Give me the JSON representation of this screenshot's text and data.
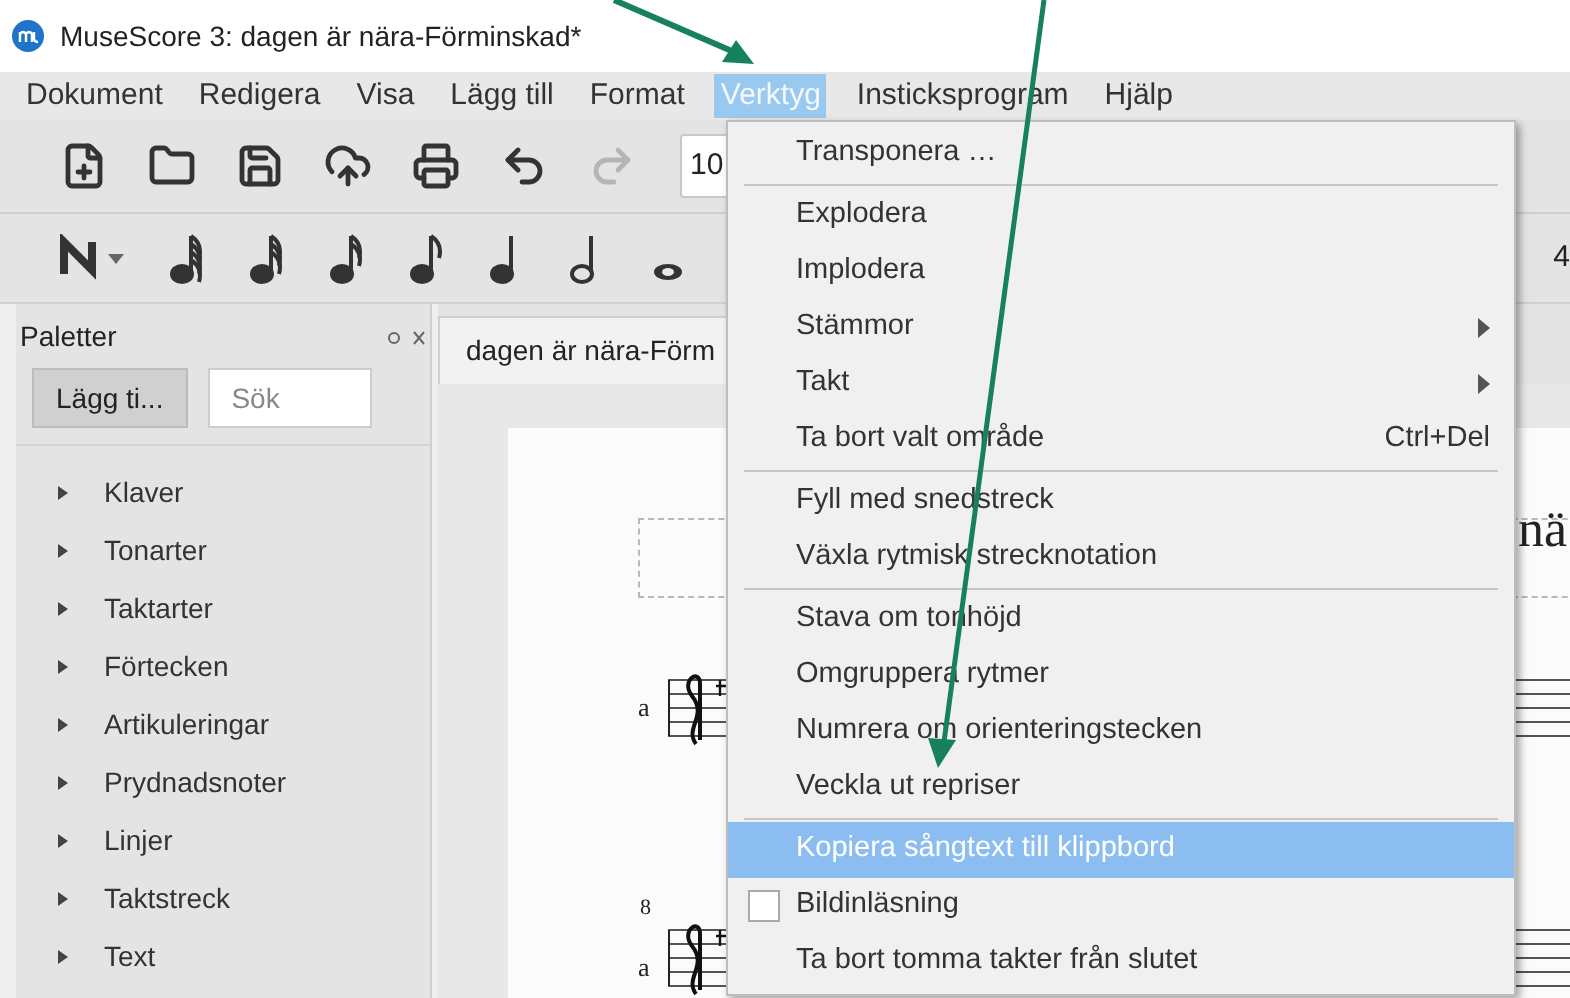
{
  "window": {
    "title": "MuseScore 3: dagen är nära-Förminskad*"
  },
  "menubar": [
    {
      "label": "Dokument",
      "selected": false
    },
    {
      "label": "Redigera",
      "selected": false
    },
    {
      "label": "Visa",
      "selected": false
    },
    {
      "label": "Lägg till",
      "selected": false
    },
    {
      "label": "Format",
      "selected": false
    },
    {
      "label": "Verktyg",
      "selected": true
    },
    {
      "label": "Insticksprogram",
      "selected": false
    },
    {
      "label": "Hjälp",
      "selected": false
    }
  ],
  "file_toolbar": {
    "buttons": [
      {
        "kind": "new",
        "disabled": false
      },
      {
        "kind": "open",
        "disabled": false
      },
      {
        "kind": "save",
        "disabled": false
      },
      {
        "kind": "upload",
        "disabled": false
      },
      {
        "kind": "print",
        "disabled": false
      },
      {
        "kind": "undo",
        "disabled": false
      },
      {
        "kind": "redo",
        "disabled": true
      }
    ],
    "zoom_value": "10"
  },
  "note_toolbar": {
    "buttons": [
      {
        "kind": "note-input"
      },
      {
        "kind": "n64"
      },
      {
        "kind": "n32"
      },
      {
        "kind": "n16"
      },
      {
        "kind": "n8"
      },
      {
        "kind": "n4"
      },
      {
        "kind": "n2"
      },
      {
        "kind": "n1"
      }
    ],
    "trailing": "4"
  },
  "palette": {
    "title": "Paletter",
    "add_button": "Lägg ti...",
    "search": {
      "placeholder": "Sök"
    },
    "items": [
      {
        "label": "Klaver",
        "expanded": false
      },
      {
        "label": "Tonarter",
        "expanded": false
      },
      {
        "label": "Taktarter",
        "expanded": false
      },
      {
        "label": "Förtecken",
        "expanded": false
      },
      {
        "label": "Artikuleringar",
        "expanded": false
      },
      {
        "label": "Prydnadsnoter",
        "expanded": false
      },
      {
        "label": "Linjer",
        "expanded": false
      },
      {
        "label": "Taktstreck",
        "expanded": false
      },
      {
        "label": "Text",
        "expanded": false
      }
    ]
  },
  "score": {
    "tab": "dagen är nära-Förm",
    "title_fragment": "nä",
    "staves": [
      {
        "label": "a"
      },
      {
        "label": "a",
        "octave_mark": "8"
      }
    ]
  },
  "menu": {
    "items": [
      {
        "kind": "item",
        "label": "Transponera …",
        "selected": false
      },
      {
        "kind": "separator"
      },
      {
        "kind": "item",
        "label": "Explodera",
        "selected": false
      },
      {
        "kind": "item",
        "label": "Implodera",
        "selected": false
      },
      {
        "kind": "submenu",
        "label": "Stämmor",
        "selected": false
      },
      {
        "kind": "submenu",
        "label": "Takt",
        "selected": false
      },
      {
        "kind": "item",
        "label": "Ta bort valt område",
        "shortcut": "Ctrl+Del",
        "selected": false
      },
      {
        "kind": "separator"
      },
      {
        "kind": "item",
        "label": "Fyll med snedstreck",
        "selected": false
      },
      {
        "kind": "item",
        "label": "Växla rytmisk strecknotation",
        "selected": false
      },
      {
        "kind": "separator"
      },
      {
        "kind": "item",
        "label": "Stava om tonhöjd",
        "selected": false
      },
      {
        "kind": "item",
        "label": "Omgruppera rytmer",
        "selected": false
      },
      {
        "kind": "item",
        "label": "Numrera om orienteringstecken",
        "selected": false
      },
      {
        "kind": "item",
        "label": "Veckla ut repriser",
        "selected": false
      },
      {
        "kind": "separator"
      },
      {
        "kind": "item",
        "label": "Kopiera sångtext till klippbord",
        "selected": true
      },
      {
        "kind": "checkbox",
        "label": "Bildinläsning",
        "checked": false,
        "selected": false
      },
      {
        "kind": "item",
        "label": "Ta bort tomma takter från slutet",
        "selected": false
      }
    ]
  }
}
